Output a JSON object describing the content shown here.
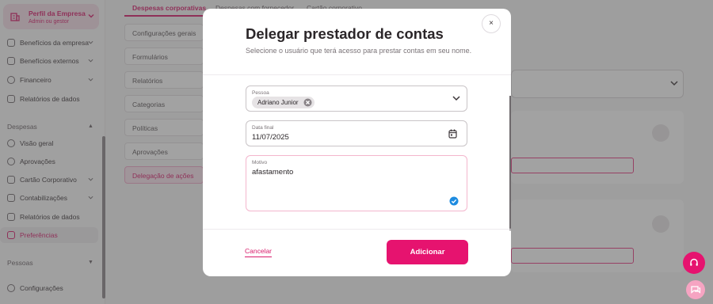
{
  "sidebar": {
    "company": {
      "name": "Perfil da Empresa",
      "role": "Admin ou gestor"
    },
    "items_top": [
      {
        "label": "Benefícios da empresa"
      },
      {
        "label": "Benefícios externos"
      },
      {
        "label": "Financeiro"
      },
      {
        "label": "Relatórios de dados"
      }
    ],
    "section_despesas": "Despesas",
    "items_despesas": [
      {
        "label": "Visão geral"
      },
      {
        "label": "Aprovações"
      },
      {
        "label": "Cartão Corporativo"
      },
      {
        "label": "Contabilizações"
      },
      {
        "label": "Relatórios de dados"
      },
      {
        "label": "Preferências"
      }
    ],
    "section_pessoas": "Pessoas",
    "item_config": "Configurações"
  },
  "tabs": [
    {
      "label": "Despesas corporativas"
    },
    {
      "label": "Despesas com fornecedor"
    },
    {
      "label": "Cartão corporativo"
    }
  ],
  "settings_list": [
    {
      "label": "Configurações gerais"
    },
    {
      "label": "Formulários"
    },
    {
      "label": "Relatórios"
    },
    {
      "label": "Categorias"
    },
    {
      "label": "Políticas"
    },
    {
      "label": "Aprovações"
    },
    {
      "label": "Delegação de ações"
    }
  ],
  "modal": {
    "title": "Delegar prestador de contas",
    "subtitle": "Selecione o usuário que terá acesso para prestar contas em seu nome.",
    "close_symbol": "×",
    "person": {
      "label": "Pessoa",
      "chip": "Adriano Junior"
    },
    "end_date": {
      "label": "Data final",
      "value": "11/07/2025"
    },
    "reason": {
      "label": "Motivo",
      "value": "afastamento"
    },
    "cancel_label": "Cancelar",
    "add_label": "Adicionar"
  },
  "colors": {
    "brand": "#e6136f",
    "overlay": "#464646"
  },
  "icons": {
    "company": "building-icon",
    "close": "close-icon",
    "chip_remove": "remove-chip-icon",
    "dropdown": "chevron-down-icon",
    "calendar": "calendar-icon",
    "valid": "check-circle-icon",
    "help": "headset-icon",
    "chat": "chat-icon"
  }
}
